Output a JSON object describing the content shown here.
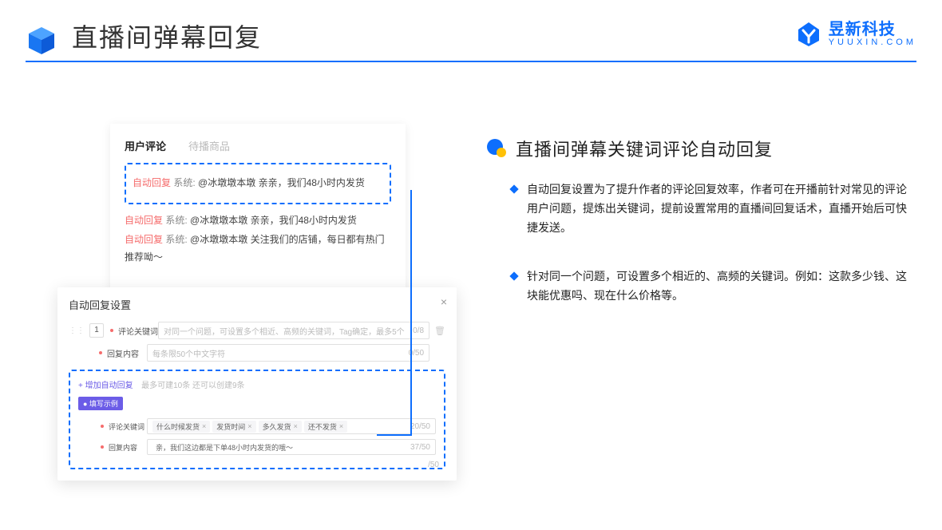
{
  "header": {
    "title": "直播间弹幕回复",
    "brand_cn": "昱新科技",
    "brand_en": "YUUXIN.COM"
  },
  "comments": {
    "tab_active": "用户评论",
    "tab_inactive": "待播商品",
    "auto_tag": "自动回复",
    "sys_tag": "系统:",
    "line1": "@冰墩墩本墩 亲亲，我们48小时内发货",
    "line2": "@冰墩墩本墩 亲亲，我们48小时内发货",
    "line3": "@冰墩墩本墩 关注我们的店铺，每日都有热门推荐呦～"
  },
  "settings": {
    "title": "自动回复设置",
    "num": "1",
    "label_keyword": "评论关键词",
    "label_reply": "回复内容",
    "placeholder_keyword": "对同一个问题，可设置多个相近、高频的关键词，Tag确定，最多5个",
    "counter_keyword": "0/8",
    "placeholder_reply": "每条限50个中文字符",
    "counter_reply": "0/50",
    "add_link": "+ 增加自动回复",
    "add_hint": "最多可建10条 还可以创建9条",
    "example_badge": "● 填写示例",
    "ex_label_kw": "评论关键词",
    "ex_label_rp": "回复内容",
    "ex_tags": [
      "什么时候发货",
      "发货时间",
      "多久发货",
      "还不发货"
    ],
    "ex_kw_counter": "20/50",
    "ex_reply": "亲，我们这边都是下单48小时内发货的哦～",
    "ex_rp_counter": "37/50",
    "stray_counter": "/50"
  },
  "right": {
    "title": "直播间弹幕关键词评论自动回复",
    "b1": "自动回复设置为了提升作者的评论回复效率，作者可在开播前针对常见的评论用户问题，提炼出关键词，提前设置常用的直播间回复话术，直播开始后可快捷发送。",
    "b2": "针对同一个问题，可设置多个相近的、高频的关键词。例如：这款多少钱、这块能优惠吗、现在什么价格等。"
  }
}
